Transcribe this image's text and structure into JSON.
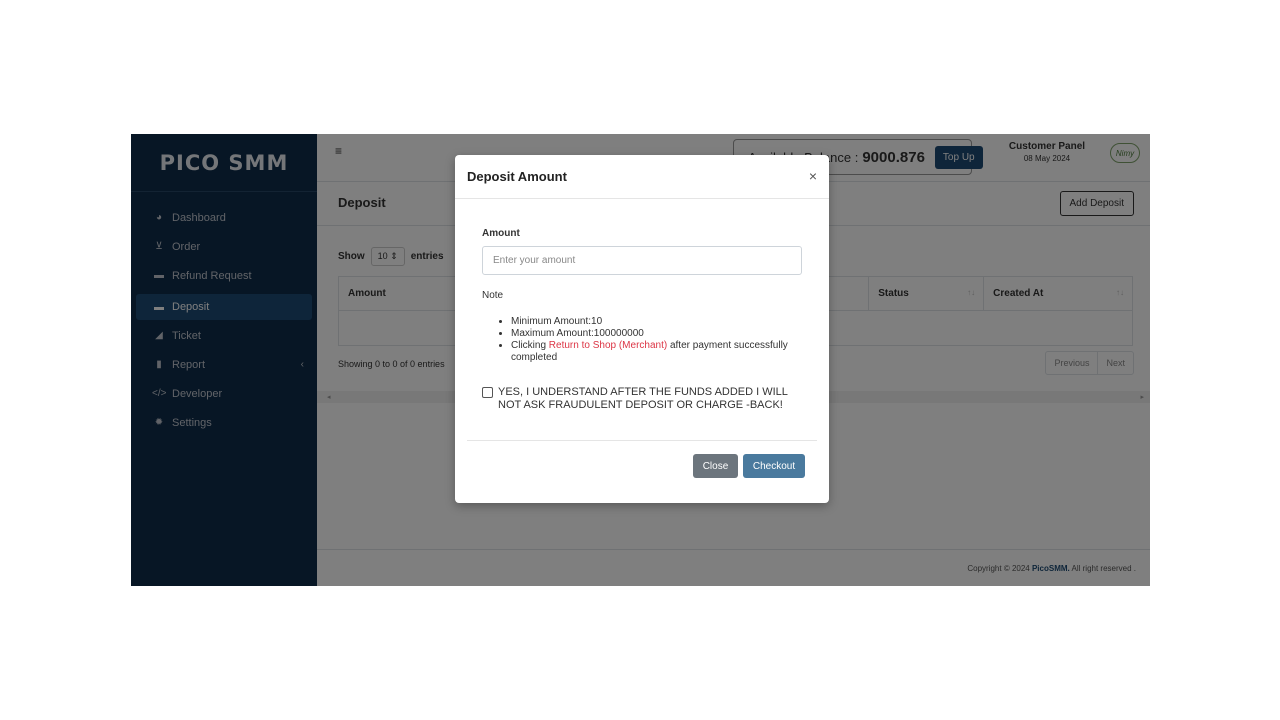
{
  "brand": "PICO SMM",
  "sidebar": {
    "items": [
      {
        "label": "Dashboard",
        "icon": "dashboard-icon"
      },
      {
        "label": "Order",
        "icon": "cart-icon"
      },
      {
        "label": "Refund Request",
        "icon": "money-icon"
      },
      {
        "label": "Deposit",
        "icon": "money-icon",
        "active": true
      },
      {
        "label": "Ticket",
        "icon": "send-icon"
      },
      {
        "label": "Report",
        "icon": "file-icon"
      },
      {
        "label": "Developer",
        "icon": "code-icon"
      },
      {
        "label": "Settings",
        "icon": "gear-icon"
      }
    ]
  },
  "topbar": {
    "menu_icon": "≡",
    "balance_label": "Available Balance :",
    "balance_value": "9000.876",
    "topup_label": "Top Up",
    "panel_title": "Customer Panel",
    "panel_date": "08 May 2024",
    "avatar_text": "Nimy"
  },
  "page": {
    "title": "Deposit",
    "add_button": "Add Deposit",
    "show_label": "Show",
    "entries_value": "10",
    "entries_label": "entries",
    "columns": [
      "Amount",
      "Status",
      "Created At"
    ],
    "showing": "Showing 0 to 0 of 0 entries",
    "prev": "Previous",
    "next": "Next"
  },
  "footer": {
    "prefix": "Copyright © 2024",
    "brand": "PicoSMM.",
    "suffix": "All right reserved ."
  },
  "modal": {
    "title": "Deposit Amount",
    "close_symbol": "×",
    "amount_label": "Amount",
    "amount_placeholder": "Enter your amount",
    "note_label": "Note",
    "rule_min": "Minimum Amount:10",
    "rule_max": "Maximum Amount:100000000",
    "rule_click_prefix": "Clicking",
    "rule_click_link": "Return to Shop (Merchant)",
    "rule_click_suffix": "after payment successfully completed",
    "agree_text": "YES, I UNDERSTAND AFTER THE FUNDS ADDED I WILL NOT ASK FRAUDULENT DEPOSIT OR CHARGE -BACK!",
    "close_button": "Close",
    "checkout_button": "Checkout"
  },
  "colors": {
    "sidebar": "#0f2d4a",
    "accent": "#1d4b74",
    "link_red": "#dc3545",
    "checkout": "#4a7a9e"
  }
}
